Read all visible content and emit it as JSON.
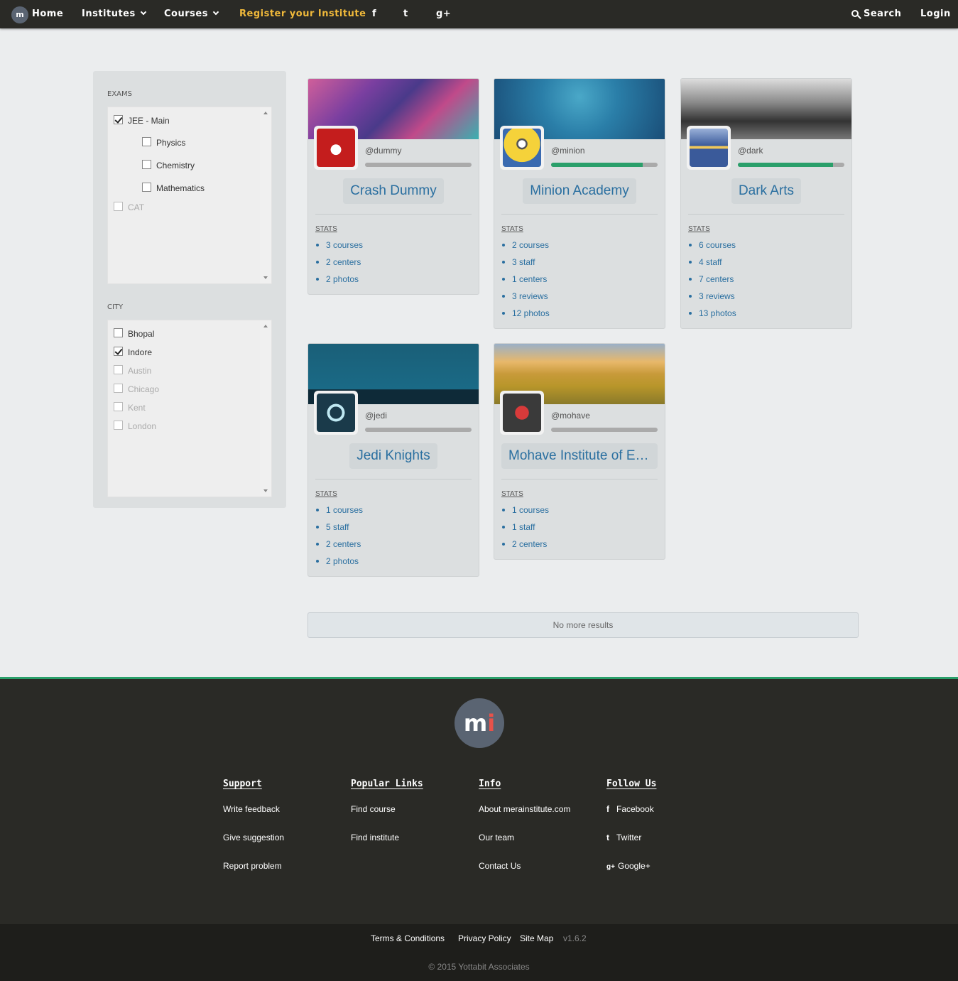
{
  "nav": {
    "logo_text": "m",
    "home": "Home",
    "institutes": "Institutes",
    "courses": "Courses",
    "register": "Register your Institute",
    "facebook_glyph": "f",
    "twitter_glyph": "t",
    "google_glyph": "g+",
    "search": "Search",
    "login": "Login"
  },
  "filters": {
    "exams_title": "EXAMS",
    "exams": [
      {
        "label": "JEE - Main",
        "checked": true,
        "disabled": false
      },
      {
        "label": "Physics",
        "checked": false,
        "disabled": false
      },
      {
        "label": "Chemistry",
        "checked": false,
        "disabled": false
      },
      {
        "label": "Mathematics",
        "checked": false,
        "disabled": false
      },
      {
        "label": "CAT",
        "checked": false,
        "disabled": true
      }
    ],
    "city_title": "CITY",
    "cities": [
      {
        "label": "Bhopal",
        "checked": false,
        "disabled": false
      },
      {
        "label": "Indore",
        "checked": true,
        "disabled": false
      },
      {
        "label": "Austin",
        "checked": false,
        "disabled": true
      },
      {
        "label": "Chicago",
        "checked": false,
        "disabled": true
      },
      {
        "label": "Kent",
        "checked": false,
        "disabled": true
      },
      {
        "label": "London",
        "checked": false,
        "disabled": true
      }
    ]
  },
  "institutes": [
    {
      "handle": "@dummy",
      "name": "Crash Dummy",
      "progress": 0,
      "stats_label": "STATS",
      "stats": [
        "3 courses",
        "2 centers",
        "2 photos"
      ]
    },
    {
      "handle": "@minion",
      "name": "Minion Academy",
      "progress": 0.86,
      "stats_label": "STATS",
      "stats": [
        "2 courses",
        "3 staff",
        "1 centers",
        "3 reviews",
        "12 photos"
      ]
    },
    {
      "handle": "@dark",
      "name": "Dark Arts",
      "progress": 0.89,
      "stats_label": "STATS",
      "stats": [
        "6 courses",
        "4 staff",
        "7 centers",
        "3 reviews",
        "13 photos"
      ]
    },
    {
      "handle": "@jedi",
      "name": "Jedi Knights",
      "progress": 0,
      "stats_label": "STATS",
      "stats": [
        "1 courses",
        "5 staff",
        "2 centers",
        "2 photos"
      ]
    },
    {
      "handle": "@mohave",
      "name": "Mohave Institute of Excellence",
      "progress": 0,
      "stats_label": "STATS",
      "stats": [
        "1 courses",
        "1 staff",
        "2 centers"
      ]
    }
  ],
  "no_more": "No more results",
  "footer": {
    "logo_m": "m",
    "logo_i": "i",
    "columns": [
      {
        "title": "Support",
        "links": [
          "Write feedback",
          "Give suggestion",
          "Report problem"
        ]
      },
      {
        "title": "Popular Links",
        "links": [
          "Find course",
          "Find institute"
        ]
      },
      {
        "title": "Info",
        "links": [
          "About merainstitute.com",
          "Our team",
          "Contact Us"
        ]
      },
      {
        "title": "Follow Us",
        "links": [
          "Facebook",
          "Twitter",
          "Google+"
        ]
      }
    ],
    "terms": "Terms & Conditions",
    "privacy": "Privacy Policy",
    "sitemap": "Site Map",
    "version": "v1.6.2",
    "copyright": "© 2015 Yottabit Associates"
  }
}
